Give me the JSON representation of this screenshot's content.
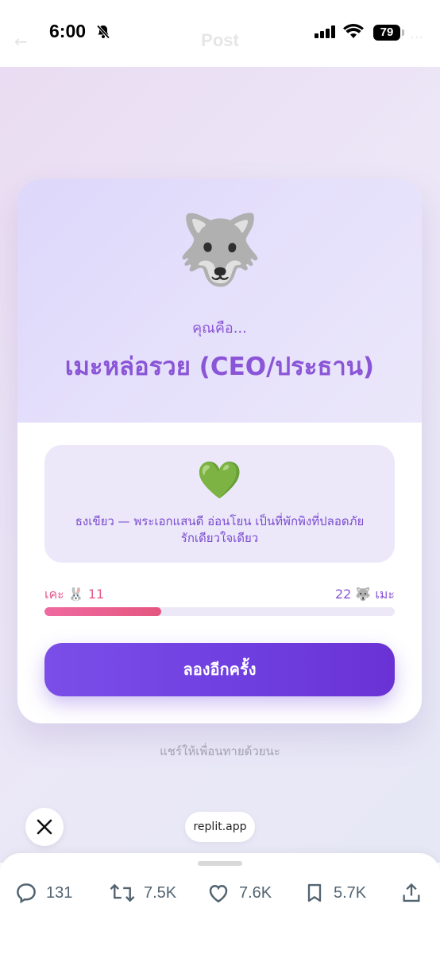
{
  "status_bar": {
    "time": "6:00",
    "battery": "79",
    "header_title": "Post"
  },
  "result_card": {
    "emoji": "🐺",
    "prefix": "คุณคือ...",
    "title": "เมะหล่อรวย (CEO/ประธาน)",
    "description_emoji": "💚",
    "description_line1": "ธงเขียว — พระเอกแสนดี อ่อนโยน เป็นที่พักพิงที่ปลอดภัย",
    "description_line2": "รักเดียวใจเดียว",
    "score_left_label": "เคะ 🐰 11",
    "score_right_label": "22 🐺 เมะ",
    "score_left_value": 11,
    "score_right_value": 22,
    "bar_fill_fraction": 0.333,
    "retry_label": "ลองอีกครั้ง"
  },
  "share_hint": "แชร์ให้เพื่อนทายด้วยนะ",
  "overlay": {
    "domain": "replit.app"
  },
  "actions": {
    "replies": "131",
    "reposts": "7.5K",
    "likes": "7.6K",
    "bookmarks": "5.7K"
  },
  "colors": {
    "accent_purple": "#8a55d6",
    "button_purple": "#6f3fe0",
    "score_pink": "#e45a8c"
  },
  "icons": [
    "bell-slash-icon",
    "signal-icon",
    "wifi-icon",
    "battery-icon",
    "close-icon",
    "reply-icon",
    "repost-icon",
    "like-icon",
    "bookmark-icon",
    "share-icon"
  ]
}
